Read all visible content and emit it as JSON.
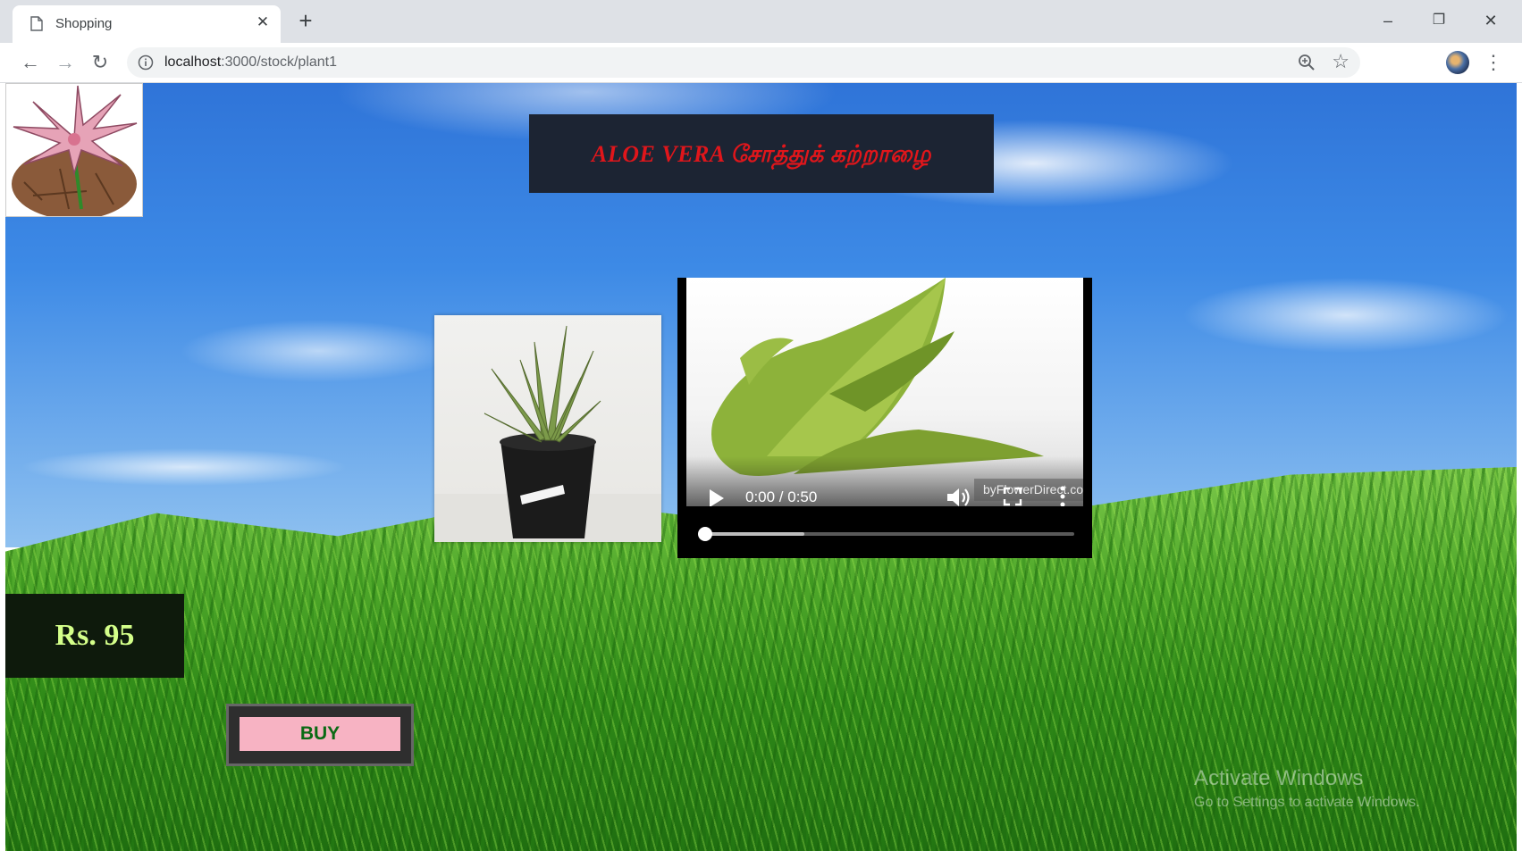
{
  "browser": {
    "tab_title": "Shopping",
    "url_host": "localhost",
    "url_path": ":3000/stock/plant1"
  },
  "page": {
    "title": "ALOE VERA சோத்துக் கற்றாழை",
    "video": {
      "time": "0:00 / 0:50",
      "watermark": "byFlowerDirect.com",
      "progress_fraction": 0.0,
      "buffered_fraction": 0.27
    },
    "price": "Rs. 95",
    "buy_label": "BUY"
  },
  "os_overlay": {
    "activate_title": "Activate Windows",
    "activate_sub": "Go to Settings to activate Windows."
  },
  "colors": {
    "title_text": "#e0161b",
    "price_text": "#d4ff8a",
    "buy_bg": "#f7b3c3",
    "buy_text": "#0a6a14"
  }
}
